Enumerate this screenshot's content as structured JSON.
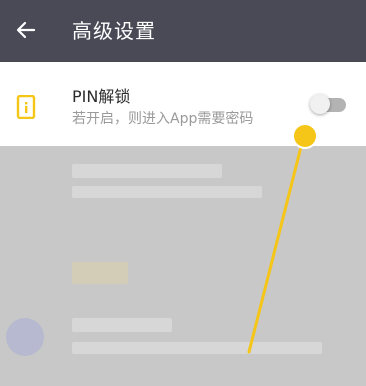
{
  "header": {
    "title": "高级设置",
    "back_icon": "arrow-left-icon"
  },
  "settings": {
    "pin_unlock": {
      "title": "PIN解锁",
      "subtitle": "若开启，则进入App需要密码",
      "icon": "phone-info-icon",
      "enabled": false
    }
  },
  "colors": {
    "appbar": "#4a4a57",
    "accent": "#f5c518",
    "overlay": "#c8c8c8"
  }
}
